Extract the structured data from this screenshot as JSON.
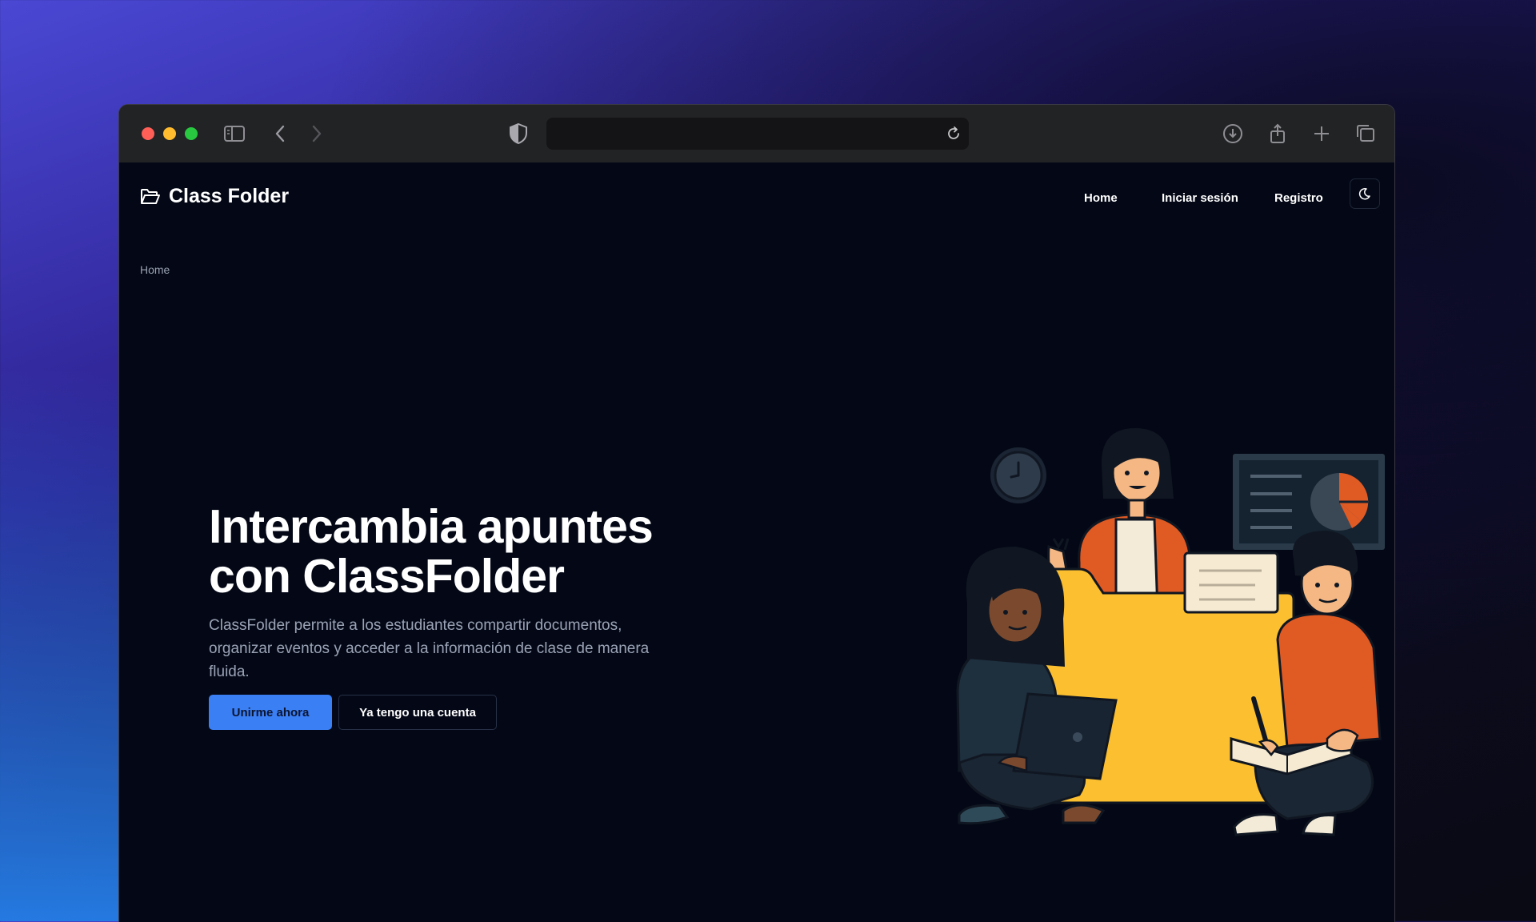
{
  "brand": {
    "name": "Class Folder",
    "icon": "folder-open-icon"
  },
  "nav": {
    "items": [
      {
        "label": "Home"
      },
      {
        "label": "Iniciar sesión"
      },
      {
        "label": "Registro"
      }
    ],
    "theme_icon": "moon-icon"
  },
  "breadcrumb": {
    "current": "Home"
  },
  "hero": {
    "title": "Intercambia apuntes con ClassFolder",
    "description": "ClassFolder permite a los estudiantes compartir documentos, organizar eventos y acceder a la información de clase de manera fluida.",
    "primary_button": "Unirme ahora",
    "secondary_button": "Ya tengo una cuenta"
  },
  "browser": {
    "url": "",
    "toolbar_icons": [
      "sidebar-icon",
      "back-icon",
      "forward-icon",
      "shield-icon",
      "reload-icon",
      "download-icon",
      "share-icon",
      "new-tab-icon",
      "tabs-overview-icon"
    ]
  },
  "colors": {
    "accent": "#3b7ff5",
    "page_background": "#040816",
    "folder": "#fbbf2f",
    "illustration_orange": "#e05a24"
  }
}
